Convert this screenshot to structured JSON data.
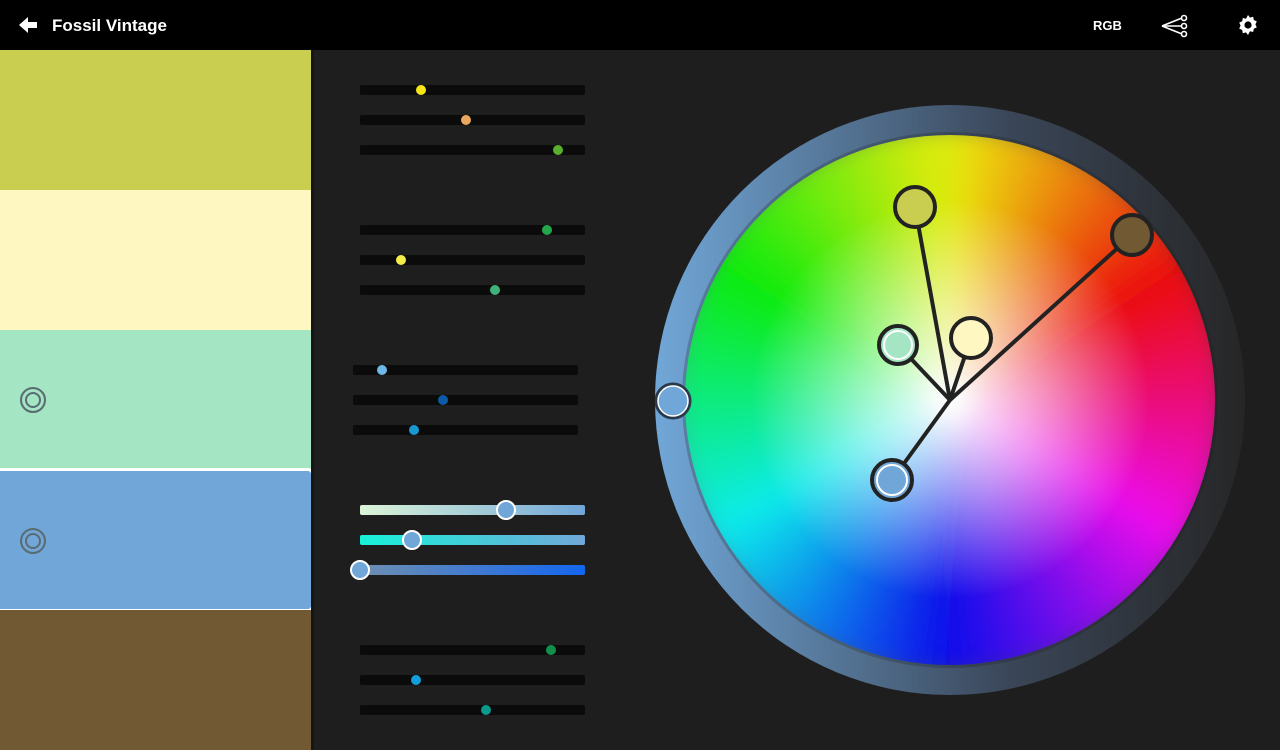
{
  "header": {
    "title": "Fossil Vintage",
    "mode_label": "RGB",
    "icons": [
      "back-arrow-icon",
      "share-icon",
      "gear-icon"
    ]
  },
  "palette": {
    "swatches": [
      {
        "color": "#c9ce51",
        "selected": false,
        "locked": false
      },
      {
        "color": "#fef7c2",
        "selected": false,
        "locked": false
      },
      {
        "color": "#a4e5c3",
        "selected": false,
        "locked": true
      },
      {
        "color": "#71a7d8",
        "selected": true,
        "locked": true
      },
      {
        "color": "#705933",
        "selected": false,
        "locked": false
      }
    ]
  },
  "slider_groups": [
    {
      "dots": [
        {
          "value": 0.27,
          "color": "#f5e619"
        },
        {
          "value": 0.47,
          "color": "#e9a85e"
        },
        {
          "value": 0.88,
          "color": "#5aae2e"
        }
      ]
    },
    {
      "dots": [
        {
          "value": 0.83,
          "color": "#22a84a"
        },
        {
          "value": 0.18,
          "color": "#f5ec4a"
        },
        {
          "value": 0.6,
          "color": "#3fb17b"
        }
      ]
    },
    {
      "dots": [
        {
          "value": 0.13,
          "color": "#6cb8e6"
        },
        {
          "value": 0.4,
          "color": "#0a5aa6"
        },
        {
          "value": 0.27,
          "color": "#1a98d0"
        }
      ]
    },
    {
      "dots": [
        {
          "value": 0.65,
          "color": "#71a7d8"
        },
        {
          "value": 0.23,
          "color": "#71a7d8"
        },
        {
          "value": 0.0,
          "color": "#71a7d8"
        }
      ]
    },
    {
      "dots": [
        {
          "value": 0.85,
          "color": "#11904c"
        },
        {
          "value": 0.25,
          "color": "#11a0db"
        },
        {
          "value": 0.56,
          "color": "#0a9a8c"
        }
      ]
    }
  ],
  "wheel": {
    "rim_color": "#71a7d8",
    "handles": [
      {
        "name": "handle-yellow-green",
        "color": "#c9ce51"
      },
      {
        "name": "handle-cream",
        "color": "#fef7c2"
      },
      {
        "name": "handle-mint",
        "color": "#a4e5c3"
      },
      {
        "name": "handle-blue",
        "color": "#71a7d8"
      },
      {
        "name": "handle-brown",
        "color": "#705933"
      }
    ]
  }
}
